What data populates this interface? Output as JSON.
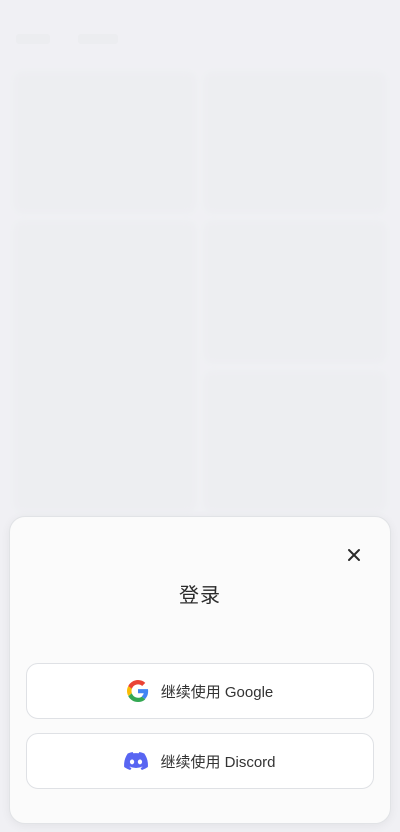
{
  "login_sheet": {
    "title": "登录",
    "google_button_label": "继续使用 Google",
    "discord_button_label": "继续使用 Discord"
  },
  "icons": {
    "close": "close-icon",
    "google": "google-logo-icon",
    "discord": "discord-logo-icon"
  },
  "colors": {
    "discord_brand": "#5865F2",
    "google_blue": "#4285F4",
    "google_red": "#EA4335",
    "google_yellow": "#FBBC05",
    "google_green": "#34A853"
  }
}
